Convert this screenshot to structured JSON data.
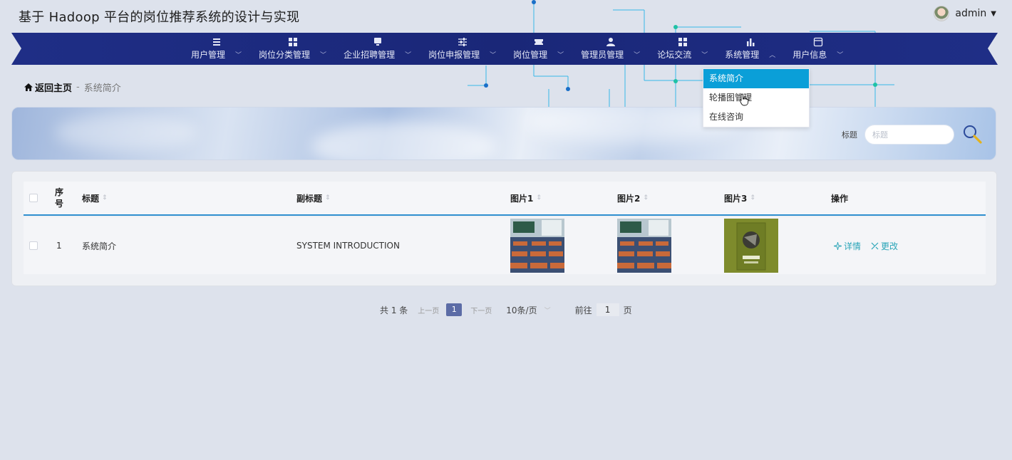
{
  "app": {
    "title": "基于 Hadoop 平台的岗位推荐系统的设计与实现",
    "user": "admin"
  },
  "nav": {
    "items": [
      {
        "label": "用户管理",
        "icon": "list-icon"
      },
      {
        "label": "岗位分类管理",
        "icon": "grid-icon"
      },
      {
        "label": "企业招聘管理",
        "icon": "monitor-icon"
      },
      {
        "label": "岗位申报管理",
        "icon": "sliders-icon"
      },
      {
        "label": "岗位管理",
        "icon": "ticket-icon"
      },
      {
        "label": "管理员管理",
        "icon": "person-icon"
      },
      {
        "label": "论坛交流",
        "icon": "grid-icon"
      },
      {
        "label": "系统管理",
        "icon": "bar-chart-icon"
      },
      {
        "label": "用户信息",
        "icon": "window-icon"
      }
    ],
    "dropdown": [
      "系统简介",
      "轮播图管理",
      "在线咨询"
    ]
  },
  "breadcrumb": {
    "home": "返回主页",
    "separator": "-",
    "current": "系统简介"
  },
  "search": {
    "label": "标题",
    "placeholder": "标题"
  },
  "table": {
    "headers": {
      "index": "序号",
      "title": "标题",
      "subtitle": "副标题",
      "pic1": "图片1",
      "pic2": "图片2",
      "pic3": "图片3",
      "actions": "操作"
    },
    "rows": [
      {
        "index": "1",
        "title": "系统简介",
        "subtitle": "SYSTEM INTRODUCTION",
        "detail": "详情",
        "edit": "更改"
      }
    ]
  },
  "pagination": {
    "total": "共 1 条",
    "prev": "上一页",
    "current": "1",
    "next": "下一页",
    "page_size": "10条/页",
    "goto_prefix": "前往",
    "goto_value": "1",
    "goto_suffix": "页"
  },
  "colors": {
    "nav_bg": "#1c2a80",
    "accent": "#0a9fd8",
    "link": "#2aa5b8",
    "page_active": "#5c6ca6"
  }
}
